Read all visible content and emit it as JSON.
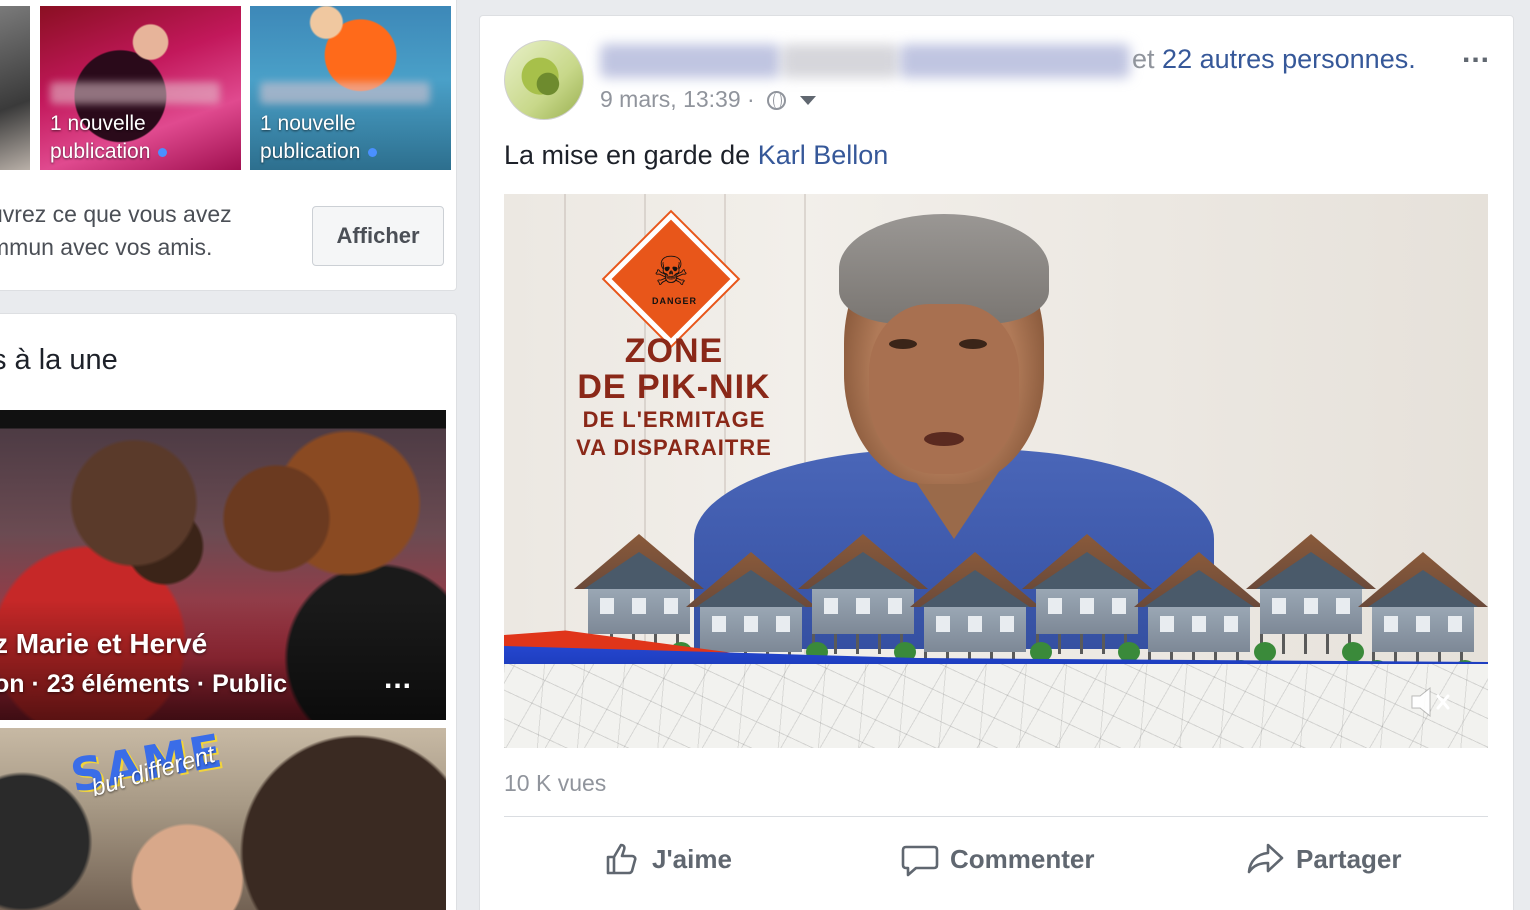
{
  "stories": {
    "items": [
      {
        "label_line1": "",
        "label_line2": ""
      },
      {
        "label_line1": "1 nouvelle",
        "label_line2": "publication"
      },
      {
        "label_line1": "1 nouvelle",
        "label_line2": "publication"
      }
    ],
    "discover_line1": "uvrez ce que vous avez",
    "discover_line2": "mmun avec vos amis.",
    "show_button": "Afficher"
  },
  "featured": {
    "title": "s à la une",
    "album1": {
      "title": "z Marie et Hervé",
      "meta": "on · 23 éléments · Public",
      "more": "..."
    },
    "album2": {
      "sticker_main": "SAME",
      "sticker_sub": "but different"
    }
  },
  "post": {
    "header_et": "et",
    "header_others": "22 autres personnes.",
    "more": "...",
    "timestamp": "9 mars, 13:39 ·",
    "text_prefix": "La mise en garde de",
    "mention": "Karl Bellon",
    "video": {
      "sign_word": "DANGER",
      "line1": "ZONE",
      "line2": "DE PIK-NIK",
      "line3": "DE L'ERMITAGE",
      "line4": "VA DISPARAITRE"
    },
    "views": "10 K vues",
    "actions": {
      "like": "J'aime",
      "comment": "Commenter",
      "share": "Partager"
    }
  },
  "colors": {
    "link": "#365899",
    "muted": "#90949c",
    "background": "#e9ebee",
    "sign_orange": "#e8561a",
    "title_red": "#8a2818"
  },
  "icons": [
    "globe-icon",
    "audience-caret-icon",
    "mute-icon",
    "like-icon",
    "comment-icon",
    "share-icon",
    "skull-icon"
  ]
}
